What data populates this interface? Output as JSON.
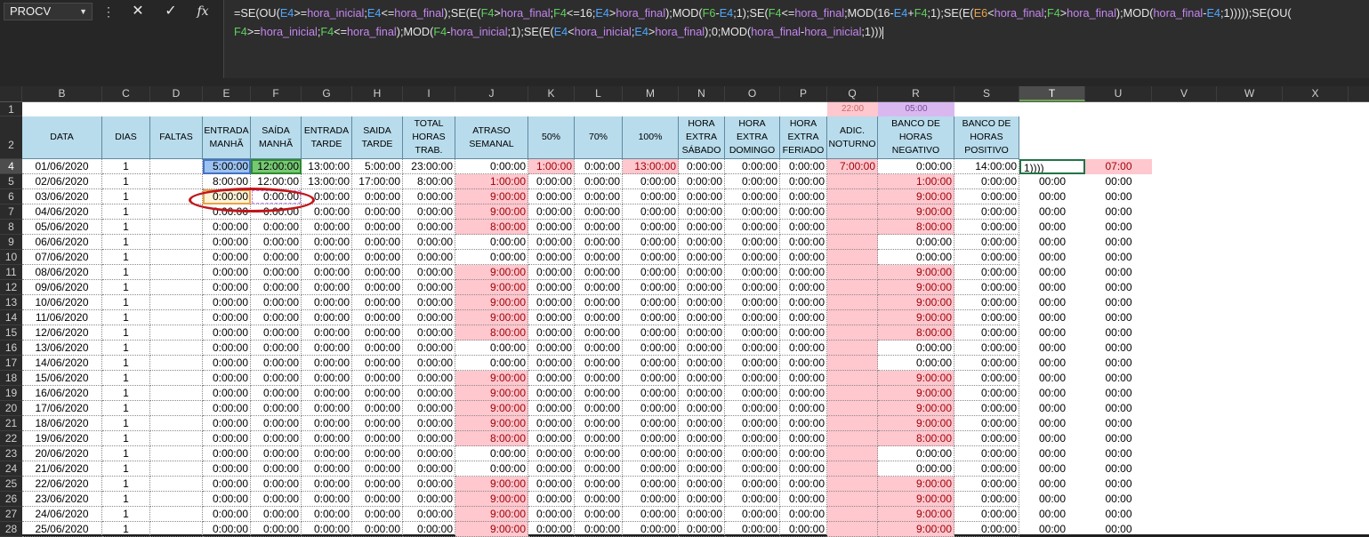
{
  "name_box": "PROCV",
  "formula_bar": {
    "cancel_icon": "close-icon",
    "enter_icon": "check-icon",
    "function_icon": "fx-icon",
    "line1": [
      {
        "t": "=SE(OU(",
        "c": ""
      },
      {
        "t": "E4",
        "c": "c-r"
      },
      {
        "t": ">=",
        "c": ""
      },
      {
        "t": "hora_inicial",
        "c": "c-p"
      },
      {
        "t": ";",
        "c": ""
      },
      {
        "t": "E4",
        "c": "c-r"
      },
      {
        "t": "<=",
        "c": ""
      },
      {
        "t": "hora_final",
        "c": "c-p"
      },
      {
        "t": ");SE(E(",
        "c": ""
      },
      {
        "t": "F4",
        "c": "c-g"
      },
      {
        "t": ">",
        "c": ""
      },
      {
        "t": "hora_final",
        "c": "c-p"
      },
      {
        "t": ";",
        "c": ""
      },
      {
        "t": "F4",
        "c": "c-g"
      },
      {
        "t": "<=16;",
        "c": ""
      },
      {
        "t": "E4",
        "c": "c-r"
      },
      {
        "t": ">",
        "c": ""
      },
      {
        "t": "hora_final",
        "c": "c-p"
      },
      {
        "t": ");MOD(",
        "c": ""
      },
      {
        "t": "F6",
        "c": "c-g"
      },
      {
        "t": "-",
        "c": ""
      },
      {
        "t": "E4",
        "c": "c-r"
      },
      {
        "t": ";1);SE(",
        "c": ""
      },
      {
        "t": "F4",
        "c": "c-g"
      },
      {
        "t": "<=",
        "c": ""
      },
      {
        "t": "hora_final",
        "c": "c-p"
      },
      {
        "t": ";MOD(16-",
        "c": ""
      },
      {
        "t": "E4",
        "c": "c-r"
      },
      {
        "t": "+",
        "c": ""
      },
      {
        "t": "F4",
        "c": "c-g"
      },
      {
        "t": ";1)",
        "c": ""
      },
      {
        "t": ";SE(E(",
        "c": ""
      },
      {
        "t": "E6",
        "c": "c-o"
      },
      {
        "t": "<",
        "c": ""
      },
      {
        "t": "hora_final",
        "c": "c-p"
      },
      {
        "t": ";",
        "c": ""
      },
      {
        "t": "F4",
        "c": "c-g"
      },
      {
        "t": ">",
        "c": ""
      },
      {
        "t": "hora_final",
        "c": "c-p"
      },
      {
        "t": ");MOD(",
        "c": ""
      },
      {
        "t": "hora_final",
        "c": "c-p"
      },
      {
        "t": "-",
        "c": ""
      },
      {
        "t": "E4",
        "c": "c-r"
      },
      {
        "t": ";1)))));SE(OU(",
        "c": ""
      }
    ],
    "line2": [
      {
        "t": "F4",
        "c": "c-g"
      },
      {
        "t": ">=",
        "c": ""
      },
      {
        "t": "hora_inicial",
        "c": "c-p"
      },
      {
        "t": ";",
        "c": ""
      },
      {
        "t": "F4",
        "c": "c-g"
      },
      {
        "t": "<=",
        "c": ""
      },
      {
        "t": "hora_final",
        "c": "c-p"
      },
      {
        "t": ");MOD(",
        "c": ""
      },
      {
        "t": "F4",
        "c": "c-g"
      },
      {
        "t": "-",
        "c": ""
      },
      {
        "t": "hora_inicial",
        "c": "c-p"
      },
      {
        "t": ";1);SE(E(",
        "c": ""
      },
      {
        "t": "E4",
        "c": "c-r"
      },
      {
        "t": "<",
        "c": ""
      },
      {
        "t": "hora_inicial",
        "c": "c-p"
      },
      {
        "t": ";",
        "c": ""
      },
      {
        "t": "E4",
        "c": "c-r"
      },
      {
        "t": ">",
        "c": ""
      },
      {
        "t": "hora_final",
        "c": "c-p"
      },
      {
        "t": ");0;MOD(",
        "c": ""
      },
      {
        "t": "hora_final",
        "c": "c-p"
      },
      {
        "t": "-",
        "c": ""
      },
      {
        "t": "hora_inicial",
        "c": "c-p"
      },
      {
        "t": ";1)))",
        "c": ""
      }
    ]
  },
  "columns": [
    "B",
    "C",
    "D",
    "E",
    "F",
    "G",
    "H",
    "I",
    "J",
    "K",
    "L",
    "M",
    "N",
    "O",
    "P",
    "Q",
    "R",
    "S",
    "T",
    "U",
    "V",
    "W",
    "X"
  ],
  "row1": {
    "Q": "22:00",
    "R": "05:00"
  },
  "headers": {
    "B": "DATA",
    "C": "DIAS",
    "D": "FALTAS",
    "E": "ENTRADA MANHÃ",
    "F": "SAÍDA MANHÃ",
    "G": "ENTRADA TARDE",
    "H": "SAIDA TARDE",
    "I": "TOTAL HORAS TRAB.",
    "J": "ATRASO SEMANAL",
    "K": "50%",
    "L": "70%",
    "M": "100%",
    "N": "HORA EXTRA SÁBADO",
    "O": "HORA EXTRA DOMINGO",
    "P": "HORA EXTRA FERIADO",
    "Q": "ADIC. NOTURNO",
    "R": "BANCO DE HORAS NEGATIVO",
    "S": "BANCO DE HORAS POSITIVO"
  },
  "rows": [
    {
      "n": "4",
      "B": "01/06/2020",
      "C": "1",
      "E": "5:00:00",
      "F": "12:00:00",
      "G": "13:00:00",
      "H": "5:00:00",
      "I": "23:00:00",
      "J": "0:00:00",
      "K": "1:00:00",
      "L": "0:00:00",
      "M": "13:00:00",
      "N": "0:00:00",
      "O": "0:00:00",
      "P": "0:00:00",
      "Q": "7:00:00",
      "R": "0:00:00",
      "S": "14:00:00",
      "T": "1))))",
      "U": "07:00"
    },
    {
      "n": "5",
      "B": "02/06/2020",
      "C": "1",
      "E": "8:00:00",
      "F": "12:00:00",
      "G": "13:00:00",
      "H": "17:00:00",
      "I": "8:00:00",
      "J": "1:00:00",
      "K": "0:00:00",
      "L": "0:00:00",
      "M": "0:00:00",
      "N": "0:00:00",
      "O": "0:00:00",
      "P": "0:00:00",
      "Q": "",
      "R": "1:00:00",
      "S": "0:00:00",
      "T": "00:00",
      "U": "00:00"
    },
    {
      "n": "6",
      "B": "03/06/2020",
      "C": "1",
      "E": "0:00:00",
      "F": "0:00:00",
      "G": "0:00:00",
      "H": "0:00:00",
      "I": "0:00:00",
      "J": "9:00:00",
      "K": "0:00:00",
      "L": "0:00:00",
      "M": "0:00:00",
      "N": "0:00:00",
      "O": "0:00:00",
      "P": "0:00:00",
      "Q": "",
      "R": "9:00:00",
      "S": "0:00:00",
      "T": "00:00",
      "U": "00:00"
    },
    {
      "n": "7",
      "B": "04/06/2020",
      "C": "1",
      "E": "0:00:00",
      "F": "0:00:00",
      "G": "0:00:00",
      "H": "0:00:00",
      "I": "0:00:00",
      "J": "9:00:00",
      "K": "0:00:00",
      "L": "0:00:00",
      "M": "0:00:00",
      "N": "0:00:00",
      "O": "0:00:00",
      "P": "0:00:00",
      "Q": "",
      "R": "9:00:00",
      "S": "0:00:00",
      "T": "00:00",
      "U": "00:00"
    },
    {
      "n": "8",
      "B": "05/06/2020",
      "C": "1",
      "E": "0:00:00",
      "F": "0:00:00",
      "G": "0:00:00",
      "H": "0:00:00",
      "I": "0:00:00",
      "J": "8:00:00",
      "K": "0:00:00",
      "L": "0:00:00",
      "M": "0:00:00",
      "N": "0:00:00",
      "O": "0:00:00",
      "P": "0:00:00",
      "Q": "",
      "R": "8:00:00",
      "S": "0:00:00",
      "T": "00:00",
      "U": "00:00"
    },
    {
      "n": "9",
      "B": "06/06/2020",
      "C": "1",
      "E": "0:00:00",
      "F": "0:00:00",
      "G": "0:00:00",
      "H": "0:00:00",
      "I": "0:00:00",
      "J": "0:00:00",
      "K": "0:00:00",
      "L": "0:00:00",
      "M": "0:00:00",
      "N": "0:00:00",
      "O": "0:00:00",
      "P": "0:00:00",
      "Q": "",
      "R": "0:00:00",
      "S": "0:00:00",
      "T": "00:00",
      "U": "00:00"
    },
    {
      "n": "10",
      "B": "07/06/2020",
      "C": "1",
      "E": "0:00:00",
      "F": "0:00:00",
      "G": "0:00:00",
      "H": "0:00:00",
      "I": "0:00:00",
      "J": "0:00:00",
      "K": "0:00:00",
      "L": "0:00:00",
      "M": "0:00:00",
      "N": "0:00:00",
      "O": "0:00:00",
      "P": "0:00:00",
      "Q": "",
      "R": "0:00:00",
      "S": "0:00:00",
      "T": "00:00",
      "U": "00:00"
    },
    {
      "n": "11",
      "B": "08/06/2020",
      "C": "1",
      "E": "0:00:00",
      "F": "0:00:00",
      "G": "0:00:00",
      "H": "0:00:00",
      "I": "0:00:00",
      "J": "9:00:00",
      "K": "0:00:00",
      "L": "0:00:00",
      "M": "0:00:00",
      "N": "0:00:00",
      "O": "0:00:00",
      "P": "0:00:00",
      "Q": "",
      "R": "9:00:00",
      "S": "0:00:00",
      "T": "00:00",
      "U": "00:00"
    },
    {
      "n": "12",
      "B": "09/06/2020",
      "C": "1",
      "E": "0:00:00",
      "F": "0:00:00",
      "G": "0:00:00",
      "H": "0:00:00",
      "I": "0:00:00",
      "J": "9:00:00",
      "K": "0:00:00",
      "L": "0:00:00",
      "M": "0:00:00",
      "N": "0:00:00",
      "O": "0:00:00",
      "P": "0:00:00",
      "Q": "",
      "R": "9:00:00",
      "S": "0:00:00",
      "T": "00:00",
      "U": "00:00"
    },
    {
      "n": "13",
      "B": "10/06/2020",
      "C": "1",
      "E": "0:00:00",
      "F": "0:00:00",
      "G": "0:00:00",
      "H": "0:00:00",
      "I": "0:00:00",
      "J": "9:00:00",
      "K": "0:00:00",
      "L": "0:00:00",
      "M": "0:00:00",
      "N": "0:00:00",
      "O": "0:00:00",
      "P": "0:00:00",
      "Q": "",
      "R": "9:00:00",
      "S": "0:00:00",
      "T": "00:00",
      "U": "00:00"
    },
    {
      "n": "14",
      "B": "11/06/2020",
      "C": "1",
      "E": "0:00:00",
      "F": "0:00:00",
      "G": "0:00:00",
      "H": "0:00:00",
      "I": "0:00:00",
      "J": "9:00:00",
      "K": "0:00:00",
      "L": "0:00:00",
      "M": "0:00:00",
      "N": "0:00:00",
      "O": "0:00:00",
      "P": "0:00:00",
      "Q": "",
      "R": "9:00:00",
      "S": "0:00:00",
      "T": "00:00",
      "U": "00:00"
    },
    {
      "n": "15",
      "B": "12/06/2020",
      "C": "1",
      "E": "0:00:00",
      "F": "0:00:00",
      "G": "0:00:00",
      "H": "0:00:00",
      "I": "0:00:00",
      "J": "8:00:00",
      "K": "0:00:00",
      "L": "0:00:00",
      "M": "0:00:00",
      "N": "0:00:00",
      "O": "0:00:00",
      "P": "0:00:00",
      "Q": "",
      "R": "8:00:00",
      "S": "0:00:00",
      "T": "00:00",
      "U": "00:00"
    },
    {
      "n": "16",
      "B": "13/06/2020",
      "C": "1",
      "E": "0:00:00",
      "F": "0:00:00",
      "G": "0:00:00",
      "H": "0:00:00",
      "I": "0:00:00",
      "J": "0:00:00",
      "K": "0:00:00",
      "L": "0:00:00",
      "M": "0:00:00",
      "N": "0:00:00",
      "O": "0:00:00",
      "P": "0:00:00",
      "Q": "",
      "R": "0:00:00",
      "S": "0:00:00",
      "T": "00:00",
      "U": "00:00"
    },
    {
      "n": "17",
      "B": "14/06/2020",
      "C": "1",
      "E": "0:00:00",
      "F": "0:00:00",
      "G": "0:00:00",
      "H": "0:00:00",
      "I": "0:00:00",
      "J": "0:00:00",
      "K": "0:00:00",
      "L": "0:00:00",
      "M": "0:00:00",
      "N": "0:00:00",
      "O": "0:00:00",
      "P": "0:00:00",
      "Q": "",
      "R": "0:00:00",
      "S": "0:00:00",
      "T": "00:00",
      "U": "00:00"
    },
    {
      "n": "18",
      "B": "15/06/2020",
      "C": "1",
      "E": "0:00:00",
      "F": "0:00:00",
      "G": "0:00:00",
      "H": "0:00:00",
      "I": "0:00:00",
      "J": "9:00:00",
      "K": "0:00:00",
      "L": "0:00:00",
      "M": "0:00:00",
      "N": "0:00:00",
      "O": "0:00:00",
      "P": "0:00:00",
      "Q": "",
      "R": "9:00:00",
      "S": "0:00:00",
      "T": "00:00",
      "U": "00:00"
    },
    {
      "n": "19",
      "B": "16/06/2020",
      "C": "1",
      "E": "0:00:00",
      "F": "0:00:00",
      "G": "0:00:00",
      "H": "0:00:00",
      "I": "0:00:00",
      "J": "9:00:00",
      "K": "0:00:00",
      "L": "0:00:00",
      "M": "0:00:00",
      "N": "0:00:00",
      "O": "0:00:00",
      "P": "0:00:00",
      "Q": "",
      "R": "9:00:00",
      "S": "0:00:00",
      "T": "00:00",
      "U": "00:00"
    },
    {
      "n": "20",
      "B": "17/06/2020",
      "C": "1",
      "E": "0:00:00",
      "F": "0:00:00",
      "G": "0:00:00",
      "H": "0:00:00",
      "I": "0:00:00",
      "J": "9:00:00",
      "K": "0:00:00",
      "L": "0:00:00",
      "M": "0:00:00",
      "N": "0:00:00",
      "O": "0:00:00",
      "P": "0:00:00",
      "Q": "",
      "R": "9:00:00",
      "S": "0:00:00",
      "T": "00:00",
      "U": "00:00"
    },
    {
      "n": "21",
      "B": "18/06/2020",
      "C": "1",
      "E": "0:00:00",
      "F": "0:00:00",
      "G": "0:00:00",
      "H": "0:00:00",
      "I": "0:00:00",
      "J": "9:00:00",
      "K": "0:00:00",
      "L": "0:00:00",
      "M": "0:00:00",
      "N": "0:00:00",
      "O": "0:00:00",
      "P": "0:00:00",
      "Q": "",
      "R": "9:00:00",
      "S": "0:00:00",
      "T": "00:00",
      "U": "00:00"
    },
    {
      "n": "22",
      "B": "19/06/2020",
      "C": "1",
      "E": "0:00:00",
      "F": "0:00:00",
      "G": "0:00:00",
      "H": "0:00:00",
      "I": "0:00:00",
      "J": "8:00:00",
      "K": "0:00:00",
      "L": "0:00:00",
      "M": "0:00:00",
      "N": "0:00:00",
      "O": "0:00:00",
      "P": "0:00:00",
      "Q": "",
      "R": "8:00:00",
      "S": "0:00:00",
      "T": "00:00",
      "U": "00:00"
    },
    {
      "n": "23",
      "B": "20/06/2020",
      "C": "1",
      "E": "0:00:00",
      "F": "0:00:00",
      "G": "0:00:00",
      "H": "0:00:00",
      "I": "0:00:00",
      "J": "0:00:00",
      "K": "0:00:00",
      "L": "0:00:00",
      "M": "0:00:00",
      "N": "0:00:00",
      "O": "0:00:00",
      "P": "0:00:00",
      "Q": "",
      "R": "0:00:00",
      "S": "0:00:00",
      "T": "00:00",
      "U": "00:00"
    },
    {
      "n": "24",
      "B": "21/06/2020",
      "C": "1",
      "E": "0:00:00",
      "F": "0:00:00",
      "G": "0:00:00",
      "H": "0:00:00",
      "I": "0:00:00",
      "J": "0:00:00",
      "K": "0:00:00",
      "L": "0:00:00",
      "M": "0:00:00",
      "N": "0:00:00",
      "O": "0:00:00",
      "P": "0:00:00",
      "Q": "",
      "R": "0:00:00",
      "S": "0:00:00",
      "T": "00:00",
      "U": "00:00"
    },
    {
      "n": "25",
      "B": "22/06/2020",
      "C": "1",
      "E": "0:00:00",
      "F": "0:00:00",
      "G": "0:00:00",
      "H": "0:00:00",
      "I": "0:00:00",
      "J": "9:00:00",
      "K": "0:00:00",
      "L": "0:00:00",
      "M": "0:00:00",
      "N": "0:00:00",
      "O": "0:00:00",
      "P": "0:00:00",
      "Q": "",
      "R": "9:00:00",
      "S": "0:00:00",
      "T": "00:00",
      "U": "00:00"
    },
    {
      "n": "26",
      "B": "23/06/2020",
      "C": "1",
      "E": "0:00:00",
      "F": "0:00:00",
      "G": "0:00:00",
      "H": "0:00:00",
      "I": "0:00:00",
      "J": "9:00:00",
      "K": "0:00:00",
      "L": "0:00:00",
      "M": "0:00:00",
      "N": "0:00:00",
      "O": "0:00:00",
      "P": "0:00:00",
      "Q": "",
      "R": "9:00:00",
      "S": "0:00:00",
      "T": "00:00",
      "U": "00:00"
    },
    {
      "n": "27",
      "B": "24/06/2020",
      "C": "1",
      "E": "0:00:00",
      "F": "0:00:00",
      "G": "0:00:00",
      "H": "0:00:00",
      "I": "0:00:00",
      "J": "9:00:00",
      "K": "0:00:00",
      "L": "0:00:00",
      "M": "0:00:00",
      "N": "0:00:00",
      "O": "0:00:00",
      "P": "0:00:00",
      "Q": "",
      "R": "9:00:00",
      "S": "0:00:00",
      "T": "00:00",
      "U": "00:00"
    },
    {
      "n": "28",
      "B": "25/06/2020",
      "C": "1",
      "E": "0:00:00",
      "F": "0:00:00",
      "G": "0:00:00",
      "H": "0:00:00",
      "I": "0:00:00",
      "J": "9:00:00",
      "K": "0:00:00",
      "L": "0:00:00",
      "M": "0:00:00",
      "N": "0:00:00",
      "O": "0:00:00",
      "P": "0:00:00",
      "Q": "",
      "R": "9:00:00",
      "S": "0:00:00",
      "T": "00:00",
      "U": "00:00"
    }
  ]
}
